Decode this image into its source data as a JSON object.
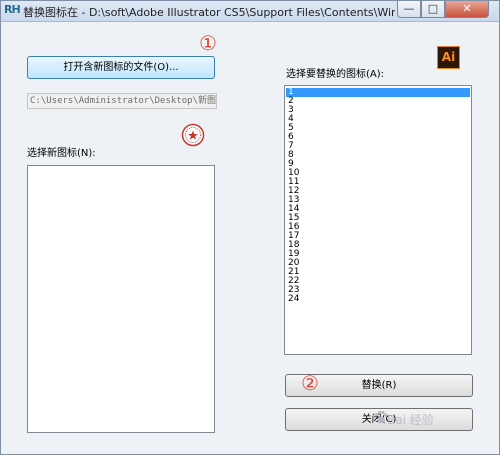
{
  "window": {
    "title": "替换图标在 - D:\\soft\\Adobe Illustrator CS5\\Support Files\\Contents\\Windows\\Illust...",
    "app_icon_text": "RH",
    "controls": {
      "minimize": "—",
      "maximize": "□",
      "close": "✕"
    }
  },
  "left": {
    "open_button_label": "打开含新图标的文件(O)...",
    "path_value": "C:\\Users\\Administrator\\Desktop\\新图标..",
    "new_icons_label": "选择新图标(N):"
  },
  "right": {
    "ai_icon_text": "Ai",
    "replace_icons_label": "选择要替换的图标(A):",
    "icon_list": [
      "1",
      "2",
      "3",
      "4",
      "5",
      "6",
      "7",
      "8",
      "9",
      "10",
      "11",
      "12",
      "13",
      "14",
      "15",
      "16",
      "17",
      "18",
      "19",
      "20",
      "21",
      "22",
      "23",
      "24"
    ],
    "selected_index": 0,
    "replace_button_label": "替换(R)",
    "close_button_label": "关闭(C)"
  },
  "annotations": {
    "step1": "①",
    "step2": "②"
  },
  "watermark": "Bai 经验"
}
